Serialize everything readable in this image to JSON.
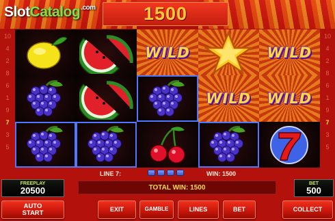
{
  "header": {
    "logo": {
      "slot": "Slot",
      "catalog": "Catalog",
      "com": ".com"
    },
    "balance": "1500"
  },
  "reels": [
    [
      "lemon",
      "grapes",
      "grapes"
    ],
    [
      "watermelon",
      "watermelon",
      "grapes"
    ],
    [
      "wild",
      "grapes",
      "cherries"
    ],
    [
      "star",
      "wild",
      "grapes"
    ],
    [
      "wild",
      "wild",
      "seven"
    ]
  ],
  "held_cells": [
    [
      0,
      2
    ],
    [
      1,
      2
    ],
    [
      2,
      1
    ],
    [
      3,
      2
    ]
  ],
  "wild_text": "WILD",
  "side_numbers": {
    "left": [
      "10",
      "4",
      "2",
      "8",
      "6",
      "1",
      "9",
      "7",
      "3",
      "5"
    ],
    "right": [
      "10",
      "4",
      "2",
      "8",
      "6",
      "1",
      "9",
      "7",
      "3",
      "5"
    ],
    "active": "7"
  },
  "info": {
    "line_label": "LINE 7:",
    "win_label": "WIN: 1500",
    "total_win": "TOTAL WIN: 1500"
  },
  "freeplay": {
    "label": "FREEPLAY",
    "value": "20500"
  },
  "bet": {
    "label": "BET",
    "value": "500"
  },
  "buttons": {
    "autostart": "AUTO\nSTART",
    "exit": "EXIT",
    "gamble": "GAMBLE",
    "lines": "LINES",
    "bet": "BET",
    "collect": "COLLECT"
  },
  "colors": {
    "background": "#b3120c",
    "accent_gold": "#ffc83a",
    "hold_border": "#4f78ff"
  }
}
